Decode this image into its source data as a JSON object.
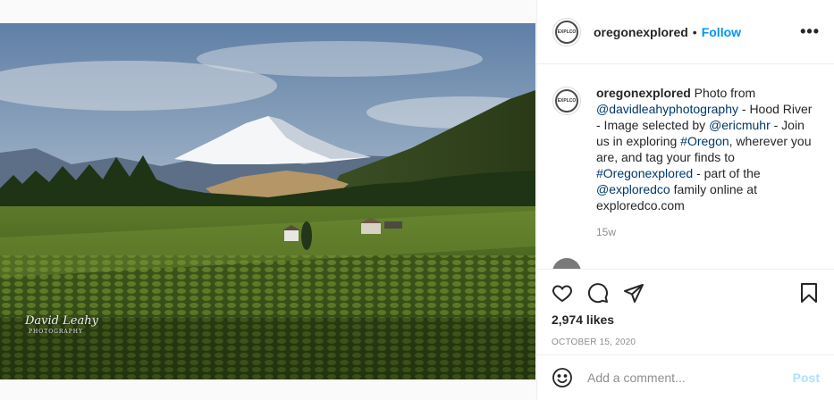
{
  "post": {
    "photo_watermark": {
      "line1": "David Leahy",
      "line2": "PHOTOGRAPHY"
    },
    "avatar_logo_text": "EXPLCO"
  },
  "header": {
    "username": "oregonexplored",
    "separator": "•",
    "follow_label": "Follow",
    "more_label": "•••"
  },
  "caption": {
    "username": "oregonexplored",
    "parts": [
      {
        "text": " Photo from ",
        "type": "text"
      },
      {
        "text": "@davidleahyphotography",
        "type": "link"
      },
      {
        "text": " - Hood River - Image selected by ",
        "type": "text"
      },
      {
        "text": "@ericmuhr",
        "type": "link"
      },
      {
        "text": " - Join us in exploring ",
        "type": "text"
      },
      {
        "text": "#Oregon",
        "type": "link"
      },
      {
        "text": ", wherever you are, and tag your finds to ",
        "type": "text"
      },
      {
        "text": "#Oregonexplored",
        "type": "link"
      },
      {
        "text": " - part of the ",
        "type": "text"
      },
      {
        "text": "@exploredco",
        "type": "link"
      },
      {
        "text": " family online at exploredco.com",
        "type": "text"
      }
    ],
    "time_ago": "15w"
  },
  "actions": {
    "icons": [
      "heart-icon",
      "comment-icon",
      "share-icon",
      "bookmark-icon"
    ],
    "likes": "2,974 likes",
    "date": "OCTOBER 15, 2020"
  },
  "comment_box": {
    "placeholder": "Add a comment...",
    "post_label": "Post"
  },
  "colors": {
    "accent": "#0095f6",
    "link": "#00376b",
    "post_disabled": "#b2dffc",
    "muted": "#8e8e8e"
  }
}
